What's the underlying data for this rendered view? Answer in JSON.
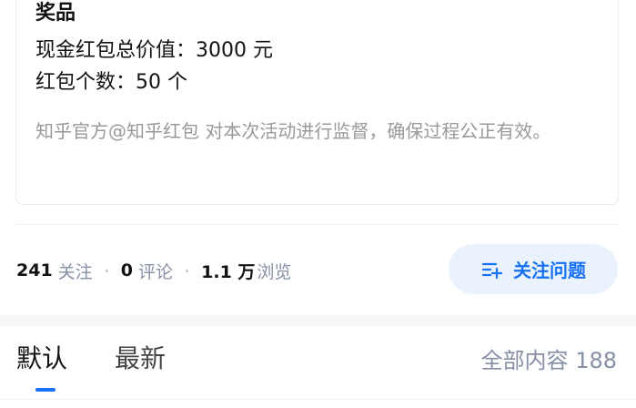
{
  "prize": {
    "title": "奖品",
    "cash_total": "现金红包总价值：3000 元",
    "count": "红包个数：50 个",
    "note": "知乎官方@知乎红包 对本次活动进行监督，确保过程公正有效。"
  },
  "stats": {
    "followers_num": "241",
    "followers_label": "关注",
    "comments_num": "0",
    "comments_label": "评论",
    "views_num": "1.1 万",
    "views_label": "浏览",
    "separator": "·"
  },
  "follow_button": {
    "label": "关注问题",
    "icon": "follow-list-plus-icon"
  },
  "tabs": [
    {
      "label": "默认",
      "active": true
    },
    {
      "label": "最新",
      "active": false
    }
  ],
  "content_count": "全部内容 188",
  "colors": {
    "accent": "#1772f6",
    "accent_bg": "#e9f2fd",
    "muted": "#8590a6",
    "note": "#999999"
  }
}
